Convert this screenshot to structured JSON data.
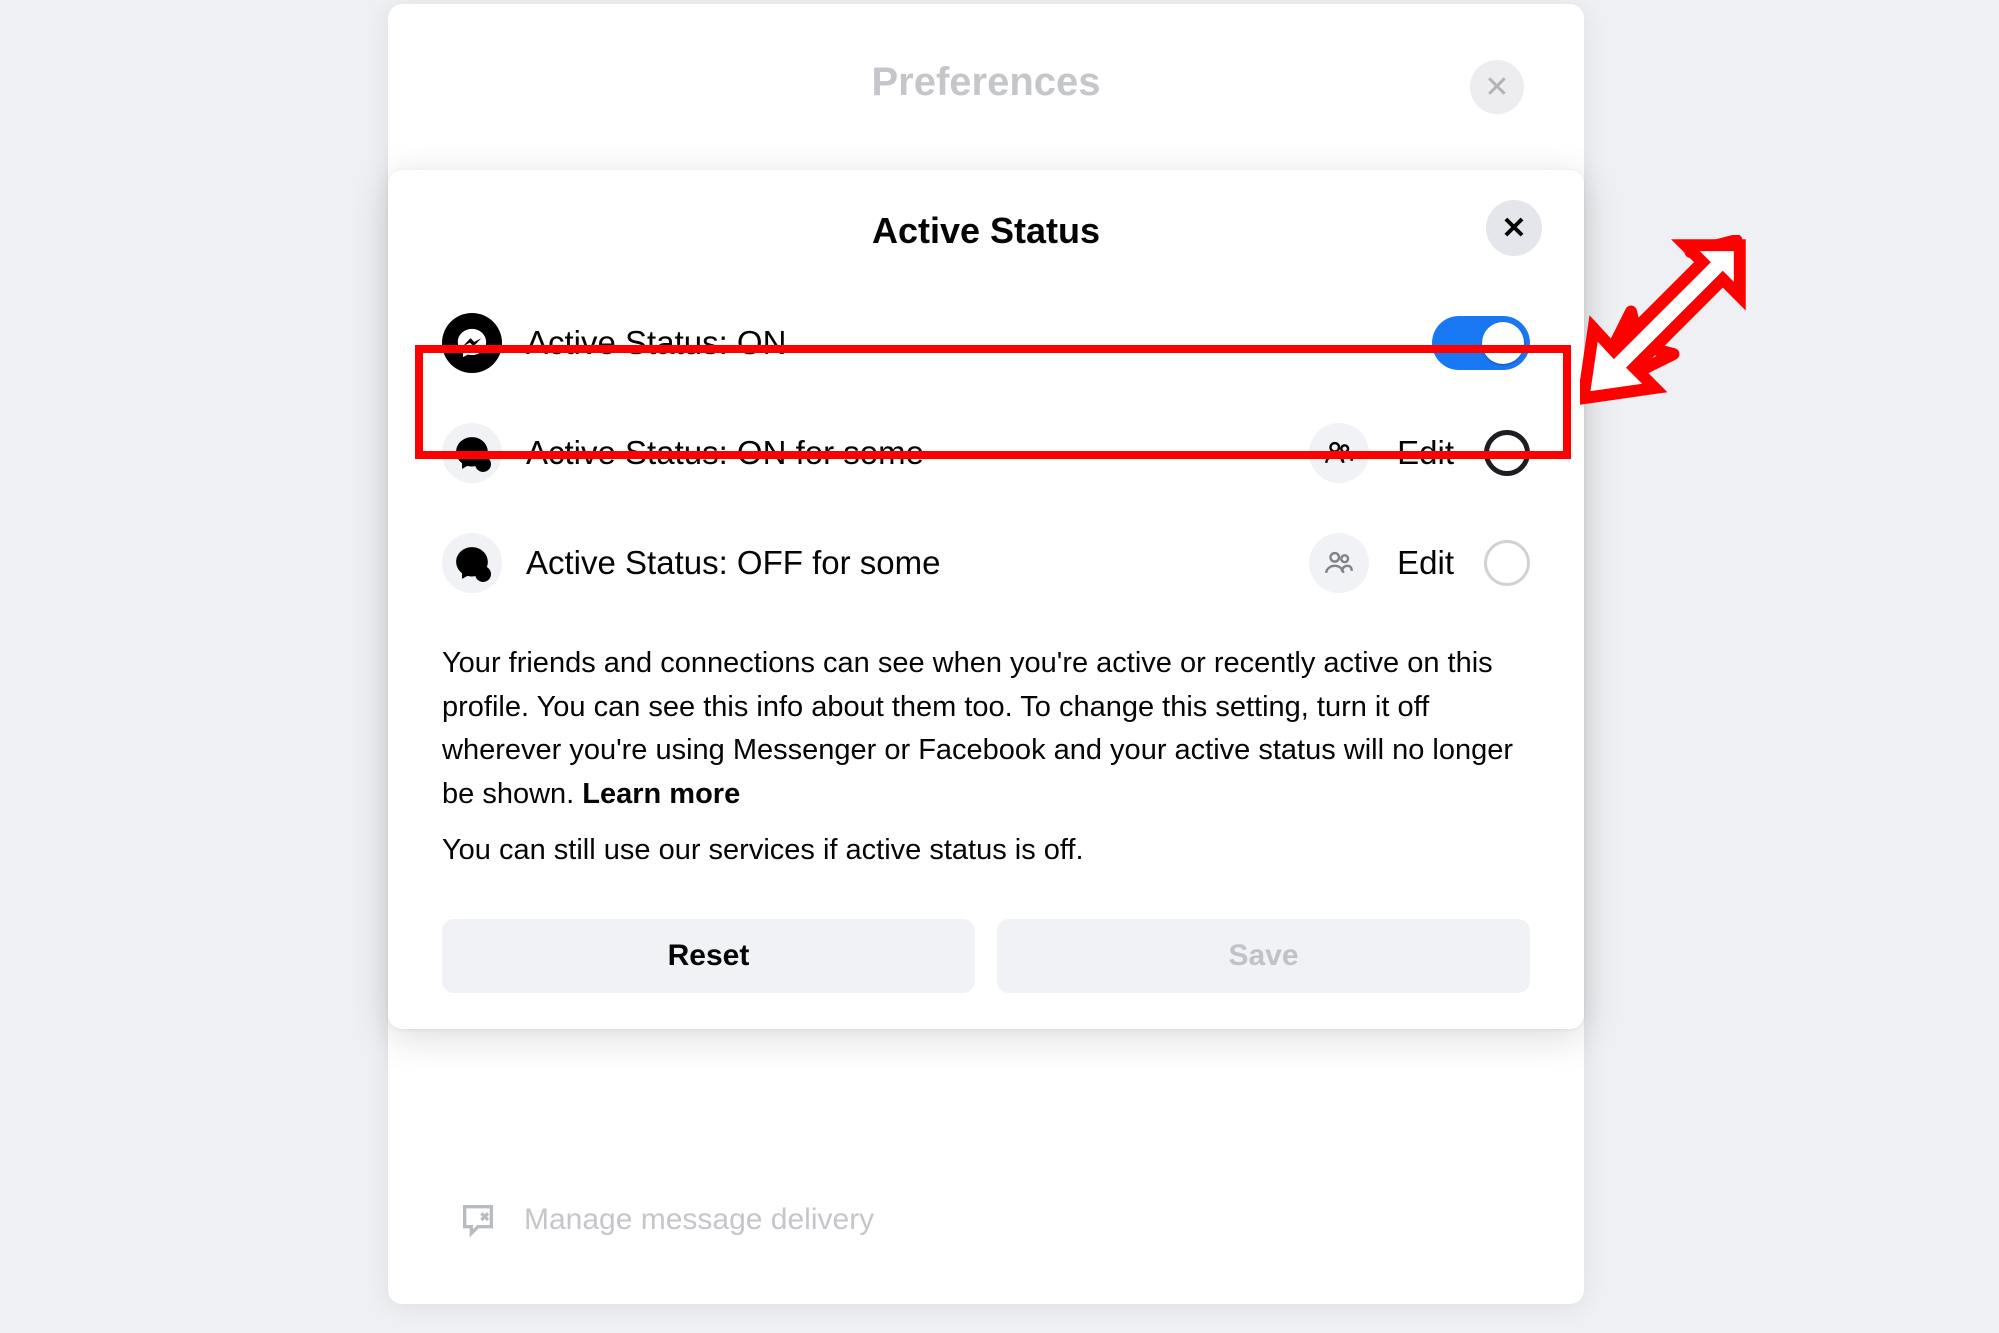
{
  "background": {
    "preferences_title": "Preferences",
    "delivery_label": "Manage message delivery"
  },
  "dialog": {
    "title": "Active Status",
    "options": {
      "on": {
        "label": "Active Status: ON"
      },
      "some_on": {
        "label": "Active Status: ON for some",
        "edit": "Edit"
      },
      "some_off": {
        "label": "Active Status: OFF for some",
        "edit": "Edit"
      }
    },
    "description_main": "Your friends and connections can see when you're active or recently active on this profile. You can see this info about them too. To change this setting, turn it off wherever you're using Messenger or Facebook and your active status will no longer be shown. ",
    "learn_more": "Learn more",
    "description_sub": "You can still use our services if active status is off.",
    "buttons": {
      "reset": "Reset",
      "save": "Save"
    }
  },
  "colors": {
    "accent": "#1877f2",
    "highlight": "#ff0000"
  }
}
